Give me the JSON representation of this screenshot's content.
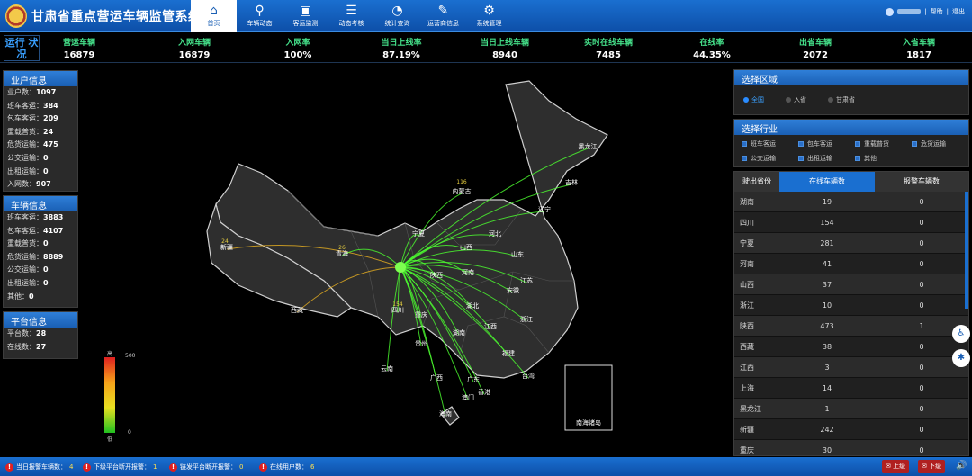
{
  "app": {
    "title": "甘肃省重点营运车辆监管系统"
  },
  "nav": [
    {
      "label": "首页",
      "icon": "home-icon",
      "glyph": "⌂"
    },
    {
      "label": "车辆动态",
      "icon": "location-pin-icon",
      "glyph": "⚲"
    },
    {
      "label": "客运监测",
      "icon": "bus-icon",
      "glyph": "▣"
    },
    {
      "label": "动态考核",
      "icon": "checklist-icon",
      "glyph": "☰"
    },
    {
      "label": "统计查询",
      "icon": "pie-chart-icon",
      "glyph": "◔"
    },
    {
      "label": "运营商信息",
      "icon": "edit-icon",
      "glyph": "✎"
    },
    {
      "label": "系统管理",
      "icon": "gear-icon",
      "glyph": "⚙"
    }
  ],
  "user": {
    "help": "帮助",
    "sep": "|",
    "logout": "退出"
  },
  "stats": {
    "heading": "运行 状况",
    "items": [
      {
        "label": "营运车辆",
        "value": "16879"
      },
      {
        "label": "入网车辆",
        "value": "16879"
      },
      {
        "label": "入网率",
        "value": "100%"
      },
      {
        "label": "当日上线率",
        "value": "87.19%"
      },
      {
        "label": "当日上线车辆",
        "value": "8940"
      },
      {
        "label": "实时在线车辆",
        "value": "7485"
      },
      {
        "label": "在线率",
        "value": "44.35%"
      },
      {
        "label": "出省车辆",
        "value": "2072"
      },
      {
        "label": "入省车辆",
        "value": "1817"
      }
    ]
  },
  "owner_panel": {
    "title": "业户信息",
    "rows": [
      {
        "label": "业户数：",
        "value": "1097"
      },
      {
        "label": "班车客运：",
        "value": "384"
      },
      {
        "label": "包车客运：",
        "value": "209"
      },
      {
        "label": "重载普货：",
        "value": "24"
      },
      {
        "label": "危货运输：",
        "value": "475"
      },
      {
        "label": "公交运输：",
        "value": "0"
      },
      {
        "label": "出租运输：",
        "value": "0"
      },
      {
        "label": "入网数：",
        "value": "907"
      }
    ]
  },
  "vehicle_panel": {
    "title": "车辆信息",
    "rows": [
      {
        "label": "班车客运：",
        "value": "3883"
      },
      {
        "label": "包车客运：",
        "value": "4107"
      },
      {
        "label": "重载普货：",
        "value": "0"
      },
      {
        "label": "危货运输：",
        "value": "8889"
      },
      {
        "label": "公交运输：",
        "value": "0"
      },
      {
        "label": "出租运输：",
        "value": "0"
      },
      {
        "label": "其他：",
        "value": "0"
      }
    ]
  },
  "platform_panel": {
    "title": "平台信息",
    "rows": [
      {
        "label": "平台数：",
        "value": "28"
      },
      {
        "label": "在线数：",
        "value": "27"
      }
    ]
  },
  "map": {
    "inset_label": "南海诸岛",
    "legend_high": "高",
    "legend_low": "低",
    "legend_max": "500",
    "legend_min": "0",
    "provinces": [
      {
        "name": "黑龙江"
      },
      {
        "name": "吉林"
      },
      {
        "name": "辽宁"
      },
      {
        "name": "内蒙古"
      },
      {
        "name": "新疆"
      },
      {
        "name": "西藏"
      },
      {
        "name": "青海"
      },
      {
        "name": "四川"
      },
      {
        "name": "宁夏"
      },
      {
        "name": "山西"
      },
      {
        "name": "河北"
      },
      {
        "name": "山东"
      },
      {
        "name": "河南"
      },
      {
        "name": "陕西"
      },
      {
        "name": "湖北"
      },
      {
        "name": "安徽"
      },
      {
        "name": "江苏"
      },
      {
        "name": "浙江"
      },
      {
        "name": "江西"
      },
      {
        "name": "湖南"
      },
      {
        "name": "贵州"
      },
      {
        "name": "云南"
      },
      {
        "name": "广西"
      },
      {
        "name": "广东"
      },
      {
        "name": "福建"
      },
      {
        "name": "台湾"
      },
      {
        "name": "海南"
      },
      {
        "name": "重庆"
      },
      {
        "name": "澳门"
      },
      {
        "name": "香港"
      }
    ],
    "numbers": [
      "116",
      "24",
      "26",
      "154"
    ]
  },
  "region": {
    "title": "选择区域",
    "options": [
      {
        "label": "全国",
        "on": true
      },
      {
        "label": "入省",
        "on": false
      },
      {
        "label": "甘肃省",
        "on": false
      }
    ]
  },
  "industry": {
    "title": "选择行业",
    "options": [
      "班车客运",
      "包车客运",
      "重载普货",
      "危货运输",
      "公交运输",
      "出租运输",
      "其他"
    ]
  },
  "table": {
    "headers": [
      "驶出省份",
      "在线车辆数",
      "报警车辆数"
    ],
    "rows": [
      [
        "湖南",
        "19",
        "0"
      ],
      [
        "四川",
        "154",
        "0"
      ],
      [
        "宁夏",
        "281",
        "0"
      ],
      [
        "河南",
        "41",
        "0"
      ],
      [
        "山西",
        "37",
        "0"
      ],
      [
        "浙江",
        "10",
        "0"
      ],
      [
        "陕西",
        "473",
        "1"
      ],
      [
        "西藏",
        "38",
        "0"
      ],
      [
        "江西",
        "3",
        "0"
      ],
      [
        "上海",
        "14",
        "0"
      ],
      [
        "黑龙江",
        "1",
        "0"
      ],
      [
        "新疆",
        "242",
        "0"
      ],
      [
        "重庆",
        "30",
        "0"
      ]
    ]
  },
  "bottom": {
    "alerts": [
      {
        "label": "当日报警车辆数：",
        "value": "4"
      },
      {
        "label": "下级平台断开报警：",
        "value": "1"
      },
      {
        "label": "链发平台断开报警：",
        "value": "0"
      },
      {
        "label": "在线用户数：",
        "value": "6"
      }
    ],
    "up": "上级",
    "down": "下级"
  }
}
